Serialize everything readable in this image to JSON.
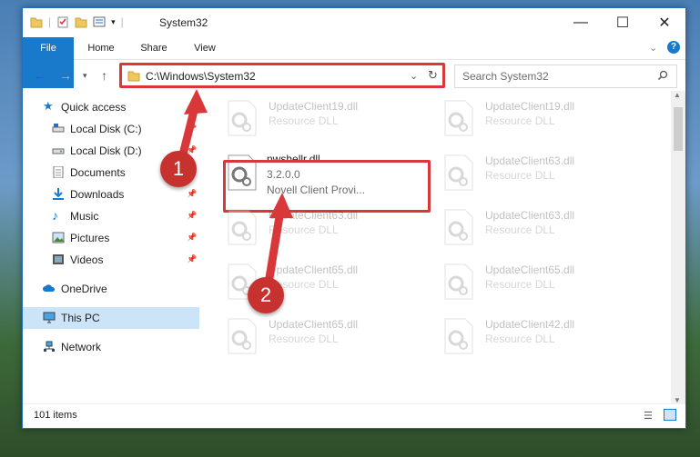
{
  "window": {
    "title": "System32"
  },
  "ribbon": {
    "tabs": [
      "File",
      "Home",
      "Share",
      "View"
    ]
  },
  "address": {
    "path": "C:\\Windows\\System32"
  },
  "search": {
    "placeholder": "Search System32"
  },
  "nav": {
    "items": [
      {
        "label": "Quick access",
        "icon": "star-icon",
        "pinned": false
      },
      {
        "label": "Local Disk (C:)",
        "icon": "drive-icon",
        "pinned": true
      },
      {
        "label": "Local Disk (D:)",
        "icon": "drive-icon",
        "pinned": true
      },
      {
        "label": "Documents",
        "icon": "documents-icon",
        "pinned": true
      },
      {
        "label": "Downloads",
        "icon": "downloads-icon",
        "pinned": true
      },
      {
        "label": "Music",
        "icon": "music-icon",
        "pinned": true
      },
      {
        "label": "Pictures",
        "icon": "pictures-icon",
        "pinned": true
      },
      {
        "label": "Videos",
        "icon": "videos-icon",
        "pinned": true
      },
      {
        "label": "OneDrive",
        "icon": "cloud-icon",
        "pinned": false
      },
      {
        "label": "This PC",
        "icon": "computer-icon",
        "pinned": false
      },
      {
        "label": "Network",
        "icon": "network-icon",
        "pinned": false
      }
    ]
  },
  "files": {
    "highlighted": {
      "name": "nwshellr.dll",
      "version": "3.2.0.0",
      "description": "Novell Client Provi..."
    },
    "background": [
      {
        "name": "UpdateClient19.dll",
        "type": "Resource DLL"
      },
      {
        "name": "UpdateClient19.dll",
        "type": "Resource DLL"
      },
      {
        "name": "UpdateClient63.dll",
        "type": "Resource DLL"
      },
      {
        "name": "UpdateClient63.dll",
        "type": "Resource DLL"
      },
      {
        "name": "UpdateClient63.dll",
        "type": "Resource DLL"
      },
      {
        "name": "UpdateClient65.dll",
        "type": "Resource DLL"
      },
      {
        "name": "UpdateClient65.dll",
        "type": "Resource DLL"
      },
      {
        "name": "UpdateClient65.dll",
        "type": "Resource DLL"
      },
      {
        "name": "UpdateClient42.dll",
        "type": "Resource DLL"
      }
    ]
  },
  "status": {
    "count": "101 items"
  },
  "annotations": {
    "step1": "1",
    "step2": "2",
    "color": "#d9383a"
  }
}
